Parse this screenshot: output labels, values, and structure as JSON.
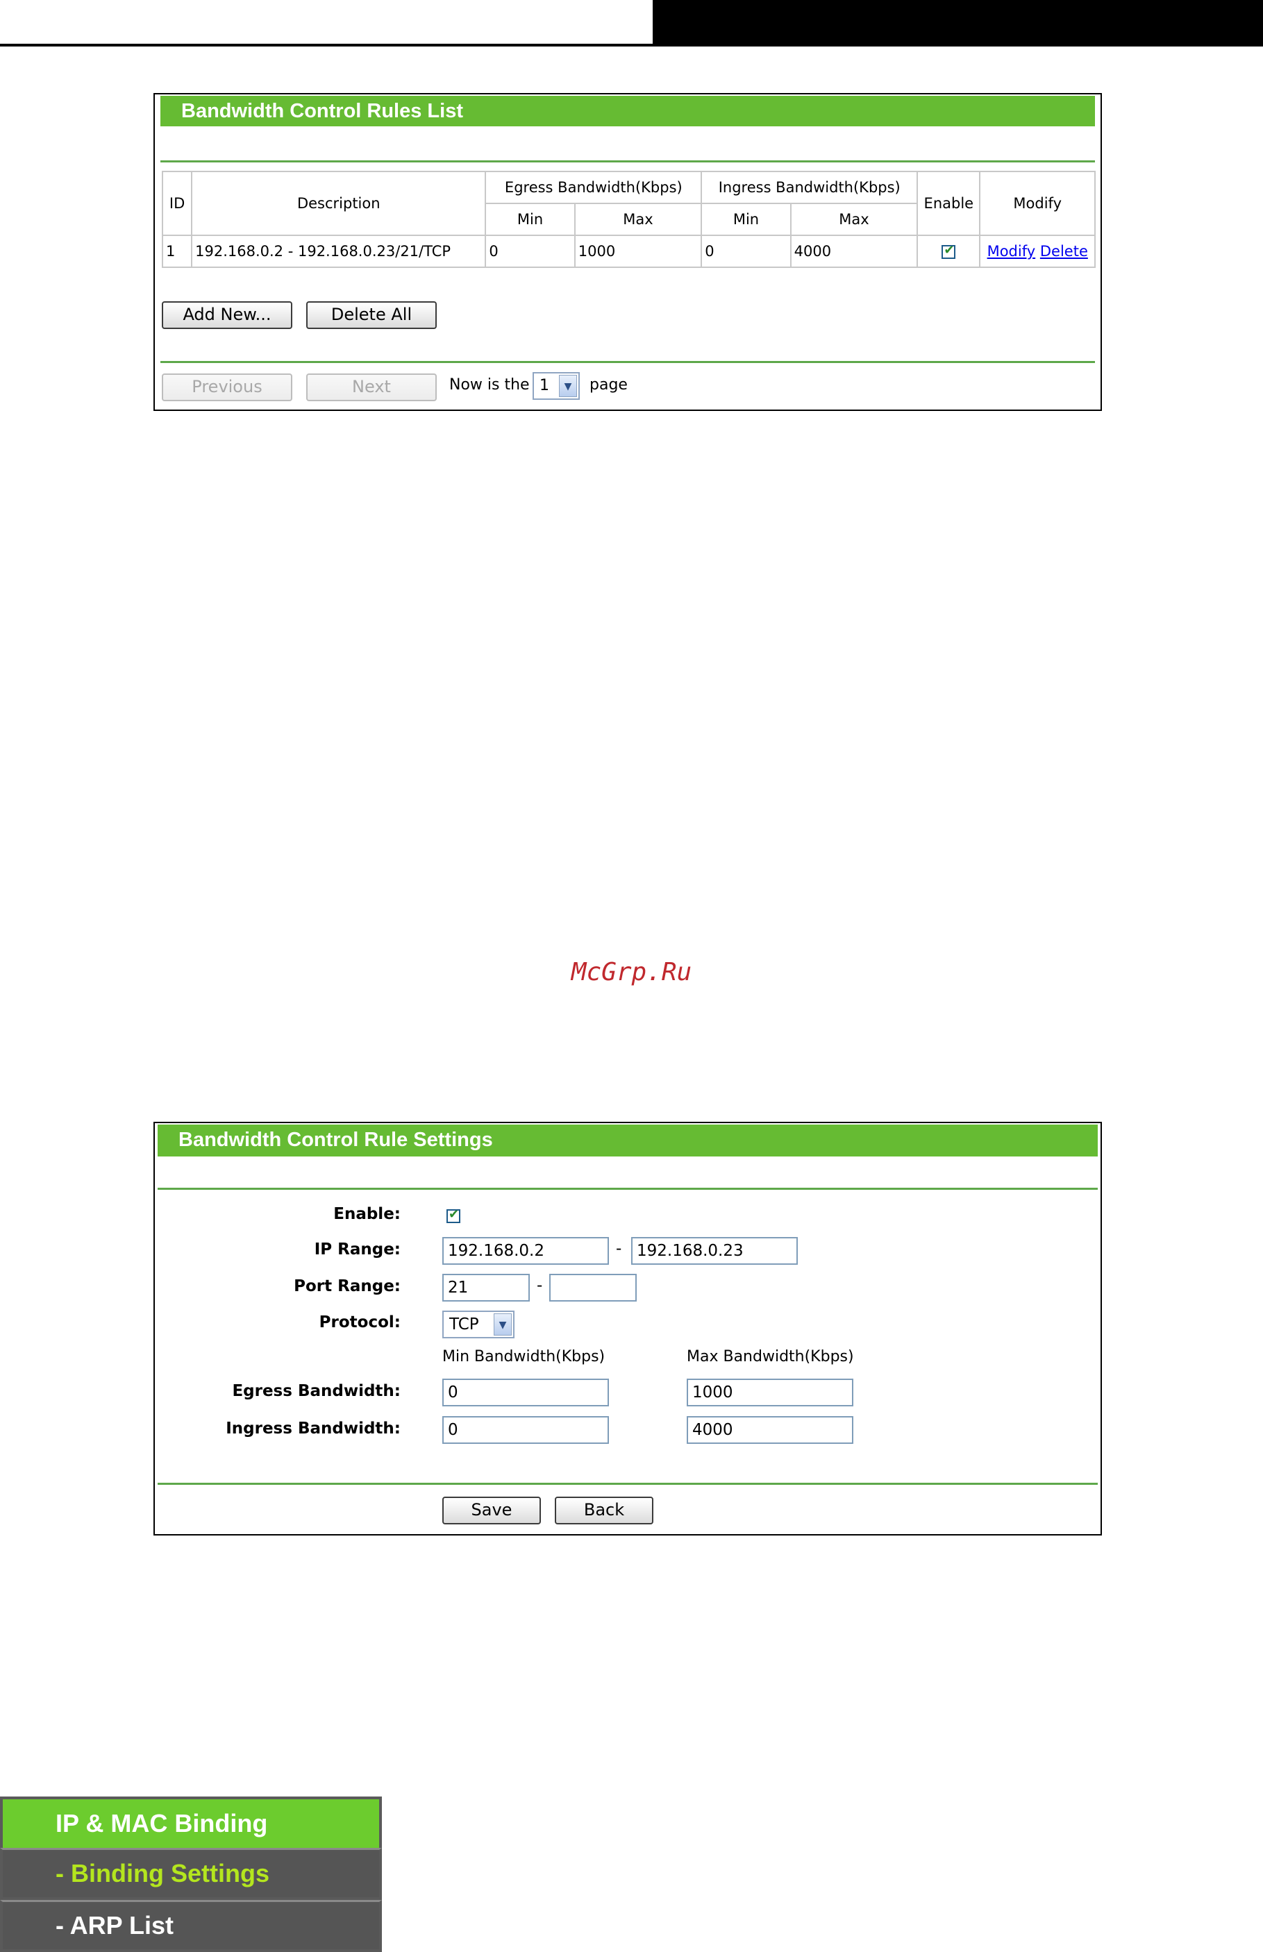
{
  "rules_list": {
    "title": "Bandwidth Control Rules List",
    "headers": {
      "id": "ID",
      "description": "Description",
      "egress": "Egress Bandwidth(Kbps)",
      "ingress": "Ingress Bandwidth(Kbps)",
      "min": "Min",
      "max": "Max",
      "enable": "Enable",
      "modify": "Modify"
    },
    "rows": [
      {
        "id": "1",
        "description": "192.168.0.2 - 192.168.0.23/21/TCP",
        "egress_min": "0",
        "egress_max": "1000",
        "ingress_min": "0",
        "ingress_max": "4000",
        "enabled": true,
        "modify_label": "Modify",
        "delete_label": "Delete"
      }
    ],
    "add_new_label": "Add New...",
    "delete_all_label": "Delete All",
    "previous_label": "Previous",
    "next_label": "Next",
    "page_prefix": "Now is the",
    "page_value": "1",
    "page_suffix": "page"
  },
  "watermark": "McGrp.Ru",
  "rule_settings": {
    "title": "Bandwidth Control Rule Settings",
    "enable_label": "Enable:",
    "enabled": true,
    "ip_range_label": "IP Range:",
    "ip_start": "192.168.0.2",
    "ip_end": "192.168.0.23",
    "port_range_label": "Port Range:",
    "port_start": "21",
    "port_end": "",
    "protocol_label": "Protocol:",
    "protocol_value": "TCP",
    "min_bw_header": "Min Bandwidth(Kbps)",
    "max_bw_header": "Max Bandwidth(Kbps)",
    "egress_label": "Egress Bandwidth:",
    "egress_min": "0",
    "egress_max": "1000",
    "ingress_label": "Ingress Bandwidth:",
    "ingress_min": "0",
    "ingress_max": "4000",
    "dash": "-",
    "save_label": "Save",
    "back_label": "Back"
  },
  "menu": {
    "header": "IP & MAC Binding",
    "items": [
      {
        "label": "- Binding Settings",
        "active": true
      },
      {
        "label": "- ARP List",
        "active": false
      }
    ]
  },
  "colors": {
    "panel_green": "#66bb33",
    "menu_green": "#6ccc2e",
    "menu_active_text": "#b4e61e",
    "watermark": "#c0282d"
  }
}
